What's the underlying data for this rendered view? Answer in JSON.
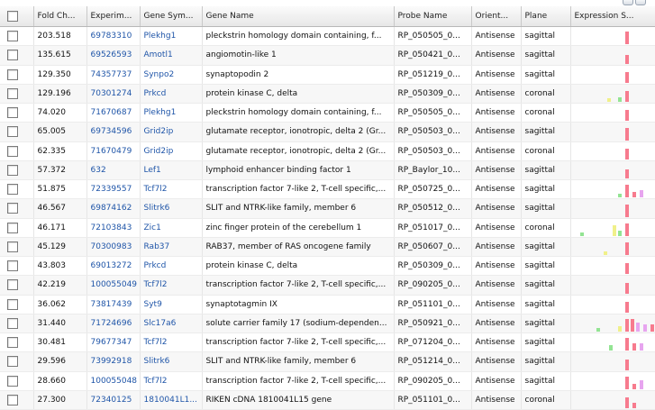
{
  "columns": [
    "",
    "Fold Ch...",
    "Experim...",
    "Gene Sym...",
    "Gene Name",
    "Probe Name",
    "Orient...",
    "Plane",
    "Expression S..."
  ],
  "colors": {
    "pink": "#f77b8e",
    "yellow": "#f0f08a",
    "green": "#93e493",
    "lilac": "#e7a5ef"
  },
  "rows": [
    {
      "fold": "203.518",
      "exp": "69783310",
      "sym": "Plekhg1",
      "name": "pleckstrin homology domain containing, f...",
      "probe": "RP_050505_0...",
      "orient": "Antisense",
      "plane": "sagittal"
    },
    {
      "fold": "135.615",
      "exp": "69526593",
      "sym": "Amotl1",
      "name": "angiomotin-like 1",
      "probe": "RP_050421_0...",
      "orient": "Antisense",
      "plane": "sagittal"
    },
    {
      "fold": "129.350",
      "exp": "74357737",
      "sym": "Synpo2",
      "name": "synaptopodin 2",
      "probe": "RP_051219_0...",
      "orient": "Antisense",
      "plane": "sagittal"
    },
    {
      "fold": "129.196",
      "exp": "70301274",
      "sym": "Prkcd",
      "name": "protein kinase C, delta",
      "probe": "RP_050309_0...",
      "orient": "Antisense",
      "plane": "coronal"
    },
    {
      "fold": "74.020",
      "exp": "71670687",
      "sym": "Plekhg1",
      "name": "pleckstrin homology domain containing, f...",
      "probe": "RP_050505_0...",
      "orient": "Antisense",
      "plane": "coronal"
    },
    {
      "fold": "65.005",
      "exp": "69734596",
      "sym": "Grid2ip",
      "name": "glutamate receptor, ionotropic, delta 2 (Gr...",
      "probe": "RP_050503_0...",
      "orient": "Antisense",
      "plane": "sagittal"
    },
    {
      "fold": "62.335",
      "exp": "71670479",
      "sym": "Grid2ip",
      "name": "glutamate receptor, ionotropic, delta 2 (Gr...",
      "probe": "RP_050503_0...",
      "orient": "Antisense",
      "plane": "coronal"
    },
    {
      "fold": "57.372",
      "exp": "632",
      "sym": "Lef1",
      "name": "lymphoid enhancer binding factor 1",
      "probe": "RP_Baylor_10...",
      "orient": "Antisense",
      "plane": "sagittal"
    },
    {
      "fold": "51.875",
      "exp": "72339557",
      "sym": "Tcf7l2",
      "name": "transcription factor 7-like 2, T-cell specific,...",
      "probe": "RP_050725_0...",
      "orient": "Antisense",
      "plane": "sagittal"
    },
    {
      "fold": "46.567",
      "exp": "69874162",
      "sym": "Slitrk6",
      "name": "SLIT and NTRK-like family, member 6",
      "probe": "RP_050512_0...",
      "orient": "Antisense",
      "plane": "sagittal"
    },
    {
      "fold": "46.171",
      "exp": "72103843",
      "sym": "Zic1",
      "name": "zinc finger protein of the cerebellum 1",
      "probe": "RP_051017_0...",
      "orient": "Antisense",
      "plane": "coronal"
    },
    {
      "fold": "45.129",
      "exp": "70300983",
      "sym": "Rab37",
      "name": "RAB37, member of RAS oncogene family",
      "probe": "RP_050607_0...",
      "orient": "Antisense",
      "plane": "sagittal"
    },
    {
      "fold": "43.803",
      "exp": "69013272",
      "sym": "Prkcd",
      "name": "protein kinase C, delta",
      "probe": "RP_050309_0...",
      "orient": "Antisense",
      "plane": "sagittal"
    },
    {
      "fold": "42.219",
      "exp": "100055049",
      "sym": "Tcf7l2",
      "name": "transcription factor 7-like 2, T-cell specific,...",
      "probe": "RP_090205_0...",
      "orient": "Antisense",
      "plane": "sagittal"
    },
    {
      "fold": "36.062",
      "exp": "73817439",
      "sym": "Syt9",
      "name": "synaptotagmin IX",
      "probe": "RP_051101_0...",
      "orient": "Antisense",
      "plane": "sagittal"
    },
    {
      "fold": "31.440",
      "exp": "71724696",
      "sym": "Slc17a6",
      "name": "solute carrier family 17 (sodium-dependen...",
      "probe": "RP_050921_0...",
      "orient": "Antisense",
      "plane": "sagittal"
    },
    {
      "fold": "30.481",
      "exp": "79677347",
      "sym": "Tcf7l2",
      "name": "transcription factor 7-like 2, T-cell specific,...",
      "probe": "RP_071204_0...",
      "orient": "Antisense",
      "plane": "sagittal"
    },
    {
      "fold": "29.596",
      "exp": "73992918",
      "sym": "Slitrk6",
      "name": "SLIT and NTRK-like family, member 6",
      "probe": "RP_051214_0...",
      "orient": "Antisense",
      "plane": "sagittal"
    },
    {
      "fold": "28.660",
      "exp": "100055048",
      "sym": "Tcf7l2",
      "name": "transcription factor 7-like 2, T-cell specific,...",
      "probe": "RP_090205_0...",
      "orient": "Antisense",
      "plane": "sagittal"
    },
    {
      "fold": "27.300",
      "exp": "72340125",
      "sym": "1810041L1...",
      "name": "RIKEN cDNA 1810041L15 gene",
      "probe": "RP_051101_0...",
      "orient": "Antisense",
      "plane": "coronal"
    }
  ]
}
